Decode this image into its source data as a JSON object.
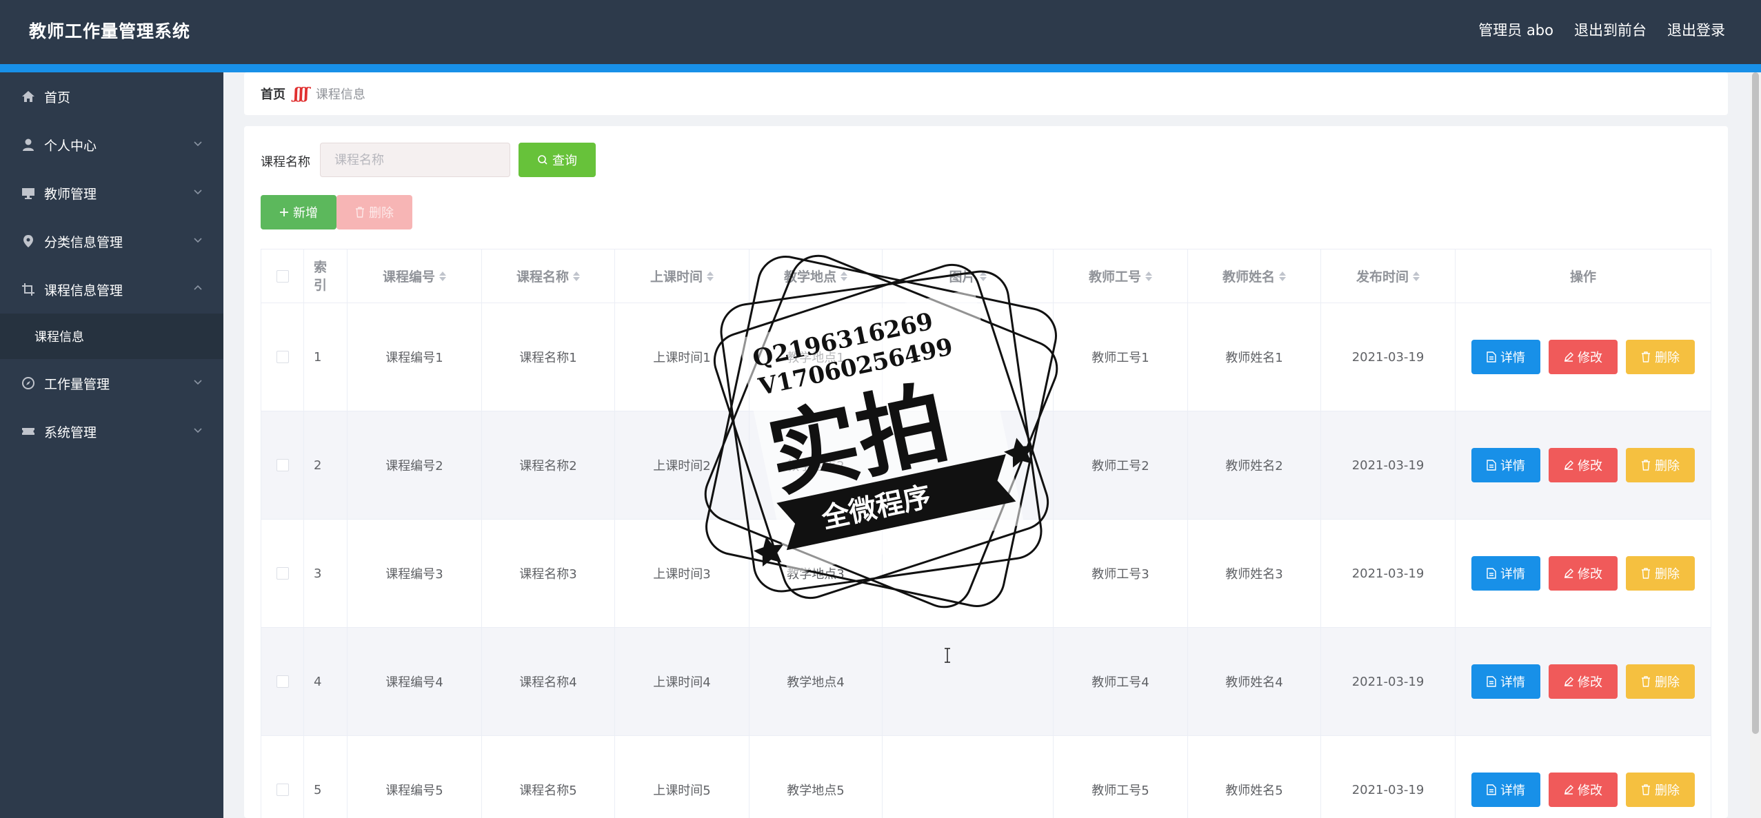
{
  "header": {
    "app_title": "教师工作量管理系统",
    "admin": "管理员 abo",
    "to_front": "退出到前台",
    "logout": "退出登录"
  },
  "sidebar": {
    "items": [
      {
        "label": "首页",
        "icon": "home-icon"
      },
      {
        "label": "个人中心",
        "icon": "user-icon"
      },
      {
        "label": "教师管理",
        "icon": "monitor-icon"
      },
      {
        "label": "分类信息管理",
        "icon": "location-pin-icon"
      },
      {
        "label": "课程信息管理",
        "icon": "crop-icon",
        "expanded": true,
        "children": [
          "课程信息"
        ]
      },
      {
        "label": "工作量管理",
        "icon": "compass-icon"
      },
      {
        "label": "系统管理",
        "icon": "ticket-icon"
      }
    ]
  },
  "breadcrumb": {
    "home": "首页",
    "separator": "ʃʃʃ",
    "current": "课程信息"
  },
  "search": {
    "label": "课程名称",
    "placeholder": "课程名称",
    "query_button": "查询"
  },
  "toolbar": {
    "add_label": "新增",
    "delete_label": "删除"
  },
  "table": {
    "headers": {
      "index": "索引",
      "course_no": "课程编号",
      "course_name": "课程名称",
      "class_time": "上课时间",
      "location": "教学地点",
      "image": "图片",
      "teacher_no": "教师工号",
      "teacher_name": "教师姓名",
      "publish_time": "发布时间",
      "actions": "操作"
    },
    "rows": [
      {
        "index": "1",
        "course_no": "课程编号1",
        "course_name": "课程名称1",
        "class_time": "上课时间1",
        "location": "教学地点1",
        "teacher_no": "教师工号1",
        "teacher_name": "教师姓名1",
        "publish_time": "2021-03-19"
      },
      {
        "index": "2",
        "course_no": "课程编号2",
        "course_name": "课程名称2",
        "class_time": "上课时间2",
        "location": "教学地点2",
        "teacher_no": "教师工号2",
        "teacher_name": "教师姓名2",
        "publish_time": "2021-03-19"
      },
      {
        "index": "3",
        "course_no": "课程编号3",
        "course_name": "课程名称3",
        "class_time": "上课时间3",
        "location": "教学地点3",
        "teacher_no": "教师工号3",
        "teacher_name": "教师姓名3",
        "publish_time": "2021-03-19"
      },
      {
        "index": "4",
        "course_no": "课程编号4",
        "course_name": "课程名称4",
        "class_time": "上课时间4",
        "location": "教学地点4",
        "teacher_no": "教师工号4",
        "teacher_name": "教师姓名4",
        "publish_time": "2021-03-19"
      },
      {
        "index": "5",
        "course_no": "课程编号5",
        "course_name": "课程名称5",
        "class_time": "上课时间5",
        "location": "教学地点5",
        "teacher_no": "教师工号5",
        "teacher_name": "教师姓名5",
        "publish_time": "2021-03-19"
      }
    ],
    "row_actions": {
      "detail": "详情",
      "edit": "修改",
      "delete": "删除"
    }
  },
  "watermark": {
    "line1": "Q2196316269",
    "line2": "V17060256499",
    "big_text": "实拍",
    "ribbon_text": "全微程序"
  },
  "colors": {
    "header_bg": "#2d3a4b",
    "accent_bar": "#1890e8",
    "query_green": "#67c23a",
    "detail_blue": "#1890e8",
    "edit_red": "#f05a5a",
    "delete_yellow": "#f5c040"
  }
}
